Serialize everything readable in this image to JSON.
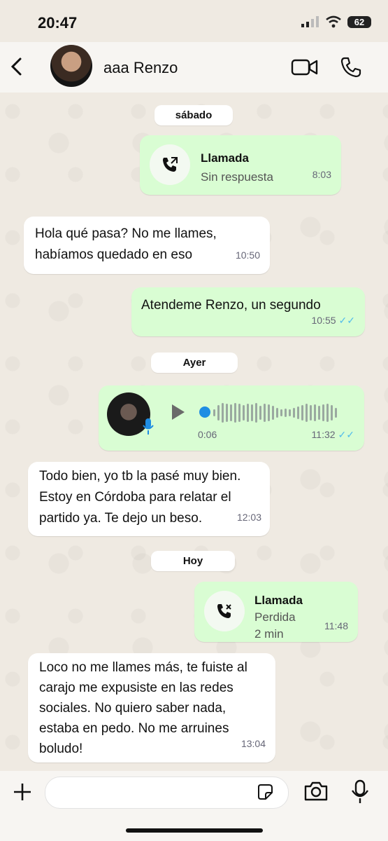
{
  "status_bar": {
    "time": "20:47",
    "battery": "62"
  },
  "header": {
    "contact_name": "aaa Renzo"
  },
  "days": {
    "d1": "sábado",
    "d2": "Ayer",
    "d3": "Hoy"
  },
  "messages": {
    "m1": {
      "title": "Llamada",
      "subtitle": "Sin respuesta",
      "time": "8:03"
    },
    "m2": {
      "line1": "Hola qué pasa? No me llames,",
      "line2": "habíamos quedado en eso",
      "time": "10:50"
    },
    "m3": {
      "text": "Atendeme Renzo, un segundo",
      "time": "10:55"
    },
    "m4": {
      "duration": "0:06",
      "time": "11:32"
    },
    "m5": {
      "line1": "Todo bien, yo tb la pasé muy bien.",
      "line2": "Estoy en Córdoba para relatar el",
      "line3": "partido ya. Te dejo un beso.",
      "time": "12:03"
    },
    "m6": {
      "title": "Llamada",
      "subtitle": "Perdida",
      "duration": "2 min",
      "time": "11:48"
    },
    "m7": {
      "line1": "Loco no me llames más, te fuiste al",
      "line2": "carajo me expusiste en las redes",
      "line3": "sociales. No quiero saber nada,",
      "line4": "estaba en pedo. No me arruines",
      "line5": "boludo!",
      "time": "13:04"
    }
  },
  "input": {
    "placeholder": ""
  },
  "colors": {
    "outgoing": "#d9fdd3",
    "incoming": "#ffffff",
    "read_ticks": "#53bdeb",
    "wallpaper": "#efeae2"
  }
}
